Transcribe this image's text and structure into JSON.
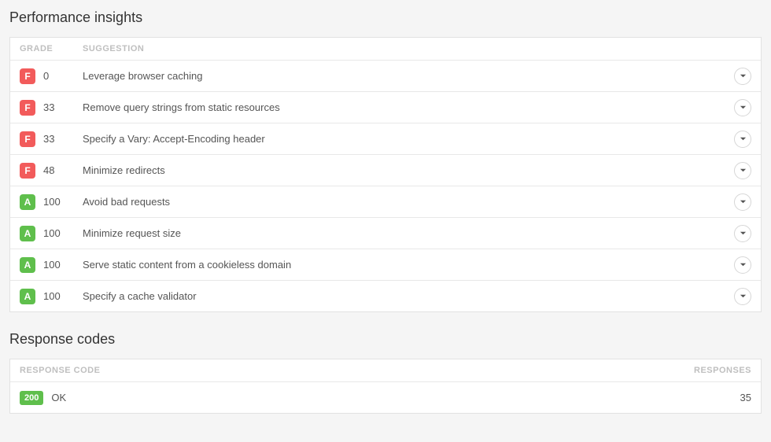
{
  "perf": {
    "title": "Performance insights",
    "headers": {
      "grade": "GRADE",
      "suggestion": "SUGGESTION"
    },
    "rows": [
      {
        "grade": "F",
        "score": "0",
        "suggestion": "Leverage browser caching"
      },
      {
        "grade": "F",
        "score": "33",
        "suggestion": "Remove query strings from static resources"
      },
      {
        "grade": "F",
        "score": "33",
        "suggestion": "Specify a Vary: Accept-Encoding header"
      },
      {
        "grade": "F",
        "score": "48",
        "suggestion": "Minimize redirects"
      },
      {
        "grade": "A",
        "score": "100",
        "suggestion": "Avoid bad requests"
      },
      {
        "grade": "A",
        "score": "100",
        "suggestion": "Minimize request size"
      },
      {
        "grade": "A",
        "score": "100",
        "suggestion": "Serve static content from a cookieless domain"
      },
      {
        "grade": "A",
        "score": "100",
        "suggestion": "Specify a cache validator"
      }
    ]
  },
  "resp": {
    "title": "Response codes",
    "headers": {
      "code": "RESPONSE CODE",
      "responses": "RESPONSES"
    },
    "rows": [
      {
        "code": "200",
        "text": "OK",
        "responses": "35"
      }
    ]
  }
}
